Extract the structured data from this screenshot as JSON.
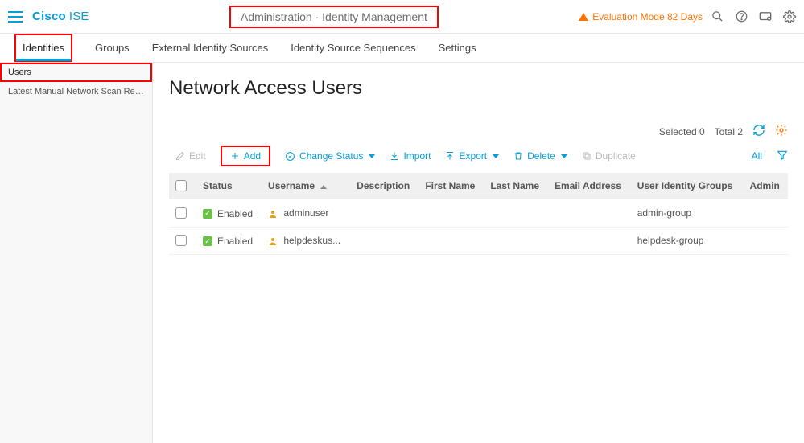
{
  "header": {
    "brand": "Cisco",
    "product": "ISE",
    "breadcrumb": "Administration · Identity Management",
    "eval_mode": "Evaluation Mode 82 Days"
  },
  "tabs": [
    {
      "label": "Identities",
      "active": true
    },
    {
      "label": "Groups"
    },
    {
      "label": "External Identity Sources"
    },
    {
      "label": "Identity Source Sequences"
    },
    {
      "label": "Settings"
    }
  ],
  "sidebar": {
    "items": [
      {
        "label": "Users",
        "selected": true
      },
      {
        "label": "Latest Manual Network Scan Res..."
      }
    ]
  },
  "page": {
    "title": "Network Access Users",
    "selected_label": "Selected 0",
    "total_label": "Total 2"
  },
  "actions": {
    "edit": "Edit",
    "add": "Add",
    "change_status": "Change Status",
    "import": "Import",
    "export": "Export",
    "delete": "Delete",
    "duplicate": "Duplicate",
    "all_filter": "All"
  },
  "table": {
    "columns": {
      "status": "Status",
      "username": "Username",
      "description": "Description",
      "first_name": "First Name",
      "last_name": "Last Name",
      "email": "Email Address",
      "groups": "User Identity Groups",
      "admin": "Admin"
    },
    "rows": [
      {
        "status": "Enabled",
        "username": "adminuser",
        "groups": "admin-group"
      },
      {
        "status": "Enabled",
        "username": "helpdeskus...",
        "groups": "helpdesk-group"
      }
    ]
  }
}
